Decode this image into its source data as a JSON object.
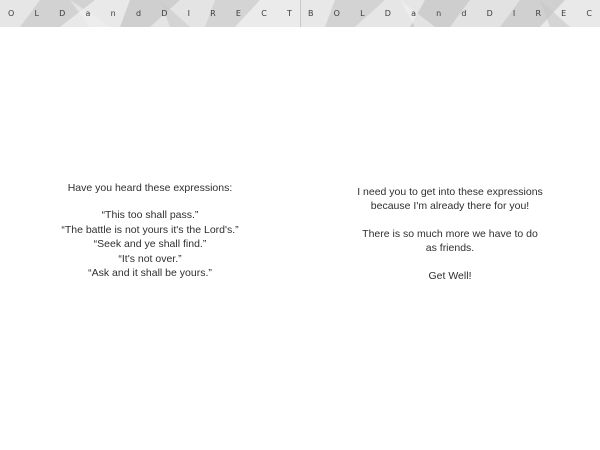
{
  "left_page": {
    "banner_letters": [
      "O",
      "L",
      "D",
      "a",
      "n",
      "d",
      "D",
      "I",
      "R",
      "E",
      "C",
      "T"
    ],
    "lines": [
      "Have you heard these expressions:",
      "",
      "“This too shall pass.”",
      "“The battle is not yours it's the Lord's.”",
      "“Seek and ye shall find.”",
      "“It's not over.”",
      "“Ask and it shall be yours.”"
    ]
  },
  "right_page": {
    "banner_letters": [
      "B",
      "O",
      "L",
      "D",
      "a",
      "n",
      "d",
      "D",
      "I",
      "R",
      "E",
      "C"
    ],
    "lines": [
      "I need you to get into these expressions",
      "because I'm already there for you!",
      "",
      "There is so much more we have to do",
      "as friends.",
      "",
      "Get Well!"
    ]
  }
}
